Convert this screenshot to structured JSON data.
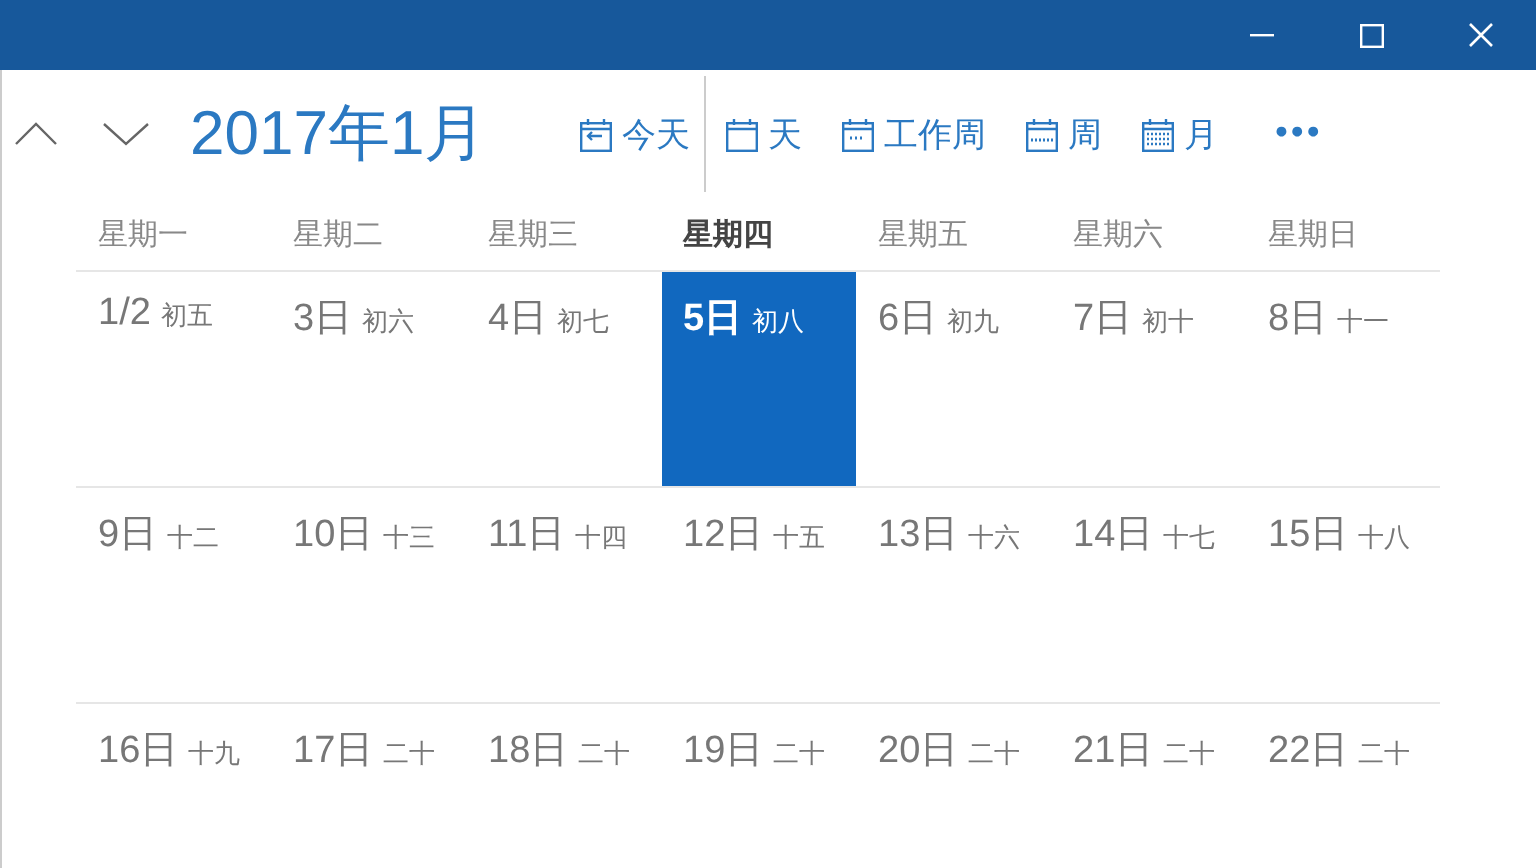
{
  "window": {
    "controls": [
      {
        "kind": "minimize"
      },
      {
        "kind": "maximize"
      },
      {
        "kind": "close"
      }
    ]
  },
  "toolbar": {
    "title": "2017年1月",
    "views": [
      {
        "label": "今天",
        "kind": "today"
      },
      {
        "label": "天",
        "kind": "day"
      },
      {
        "label": "工作周",
        "kind": "workweek"
      },
      {
        "label": "周",
        "kind": "week"
      },
      {
        "label": "月",
        "kind": "month"
      }
    ],
    "more": "•••"
  },
  "weekdays": [
    {
      "label": "星期一",
      "selected": false
    },
    {
      "label": "星期二",
      "selected": false
    },
    {
      "label": "星期三",
      "selected": false
    },
    {
      "label": "星期四",
      "selected": true
    },
    {
      "label": "星期五",
      "selected": false
    },
    {
      "label": "星期六",
      "selected": false
    },
    {
      "label": "星期日",
      "selected": false
    }
  ],
  "weeks": [
    [
      {
        "day": "1/2",
        "lunar": "初五",
        "selected": false
      },
      {
        "day": "3日",
        "lunar": "初六",
        "selected": false
      },
      {
        "day": "4日",
        "lunar": "初七",
        "selected": false
      },
      {
        "day": "5日",
        "lunar": "初八",
        "selected": true
      },
      {
        "day": "6日",
        "lunar": "初九",
        "selected": false
      },
      {
        "day": "7日",
        "lunar": "初十",
        "selected": false
      },
      {
        "day": "8日",
        "lunar": "十一",
        "selected": false
      }
    ],
    [
      {
        "day": "9日",
        "lunar": "十二",
        "selected": false
      },
      {
        "day": "10日",
        "lunar": "十三",
        "selected": false
      },
      {
        "day": "11日",
        "lunar": "十四",
        "selected": false
      },
      {
        "day": "12日",
        "lunar": "十五",
        "selected": false
      },
      {
        "day": "13日",
        "lunar": "十六",
        "selected": false
      },
      {
        "day": "14日",
        "lunar": "十七",
        "selected": false
      },
      {
        "day": "15日",
        "lunar": "十八",
        "selected": false
      }
    ],
    [
      {
        "day": "16日",
        "lunar": "十九",
        "selected": false
      },
      {
        "day": "17日",
        "lunar": "二十",
        "selected": false
      },
      {
        "day": "18日",
        "lunar": "二十",
        "selected": false
      },
      {
        "day": "19日",
        "lunar": "二十",
        "selected": false
      },
      {
        "day": "20日",
        "lunar": "二十",
        "selected": false
      },
      {
        "day": "21日",
        "lunar": "二十",
        "selected": false
      },
      {
        "day": "22日",
        "lunar": "二十",
        "selected": false
      }
    ]
  ]
}
